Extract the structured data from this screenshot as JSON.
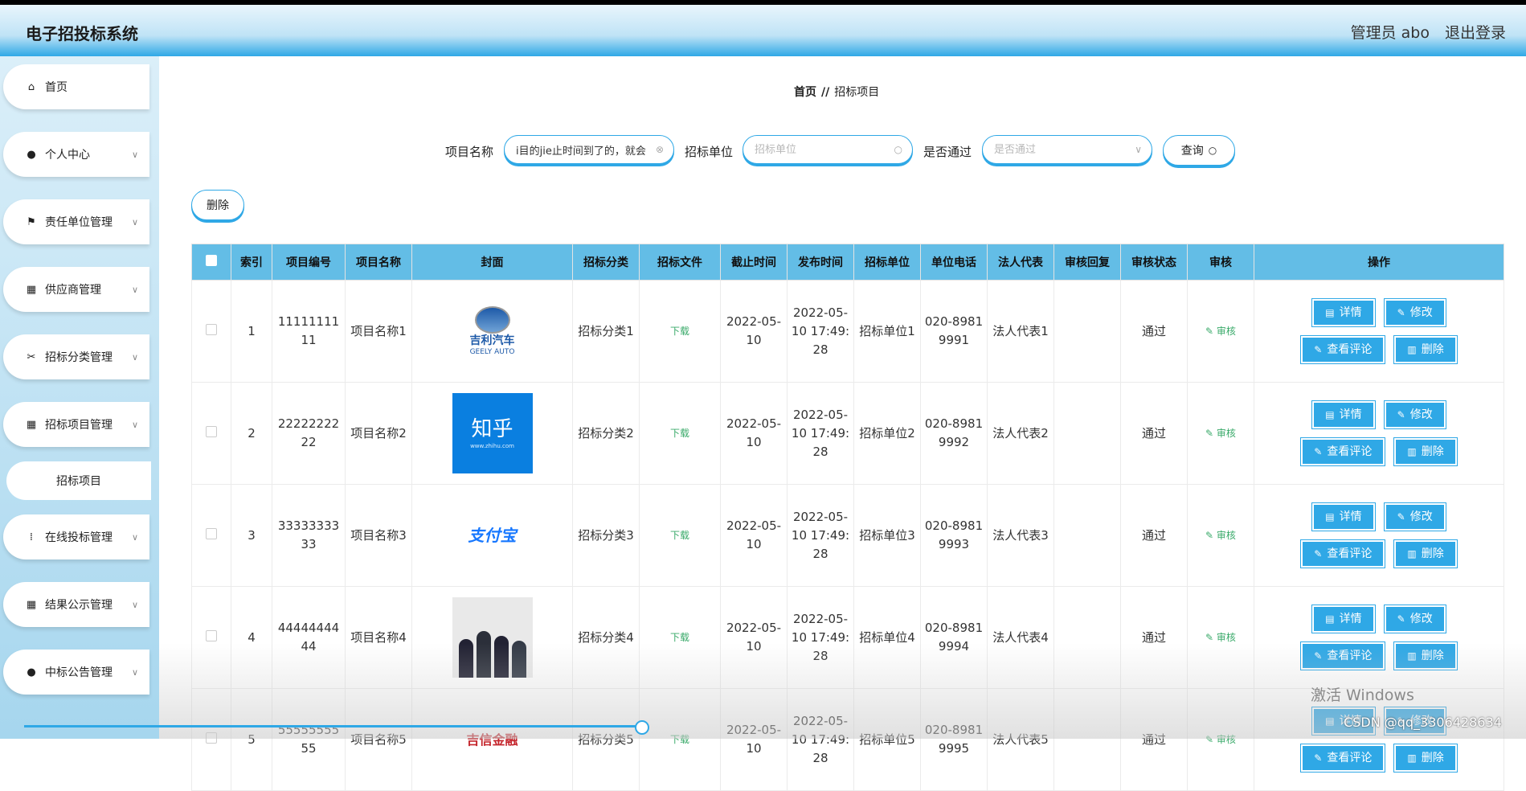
{
  "header": {
    "title": "电子招投标系统",
    "admin": "管理员 abo",
    "logout": "退出登录"
  },
  "sidebar": {
    "items": [
      {
        "label": "首页",
        "icon": "home-icon",
        "chevron": false
      },
      {
        "label": "个人中心",
        "icon": "user-icon",
        "chevron": true
      },
      {
        "label": "责任单位管理",
        "icon": "flag-icon",
        "chevron": true
      },
      {
        "label": "供应商管理",
        "icon": "grid-icon",
        "chevron": true
      },
      {
        "label": "招标分类管理",
        "icon": "ticket-icon",
        "chevron": true
      },
      {
        "label": "招标项目管理",
        "icon": "grid-icon",
        "chevron": true
      },
      {
        "label": "在线投标管理",
        "icon": "apps-icon",
        "chevron": true
      },
      {
        "label": "结果公示管理",
        "icon": "grid-icon",
        "chevron": true
      },
      {
        "label": "中标公告管理",
        "icon": "bulb-icon",
        "chevron": true
      }
    ],
    "submenu": "招标项目"
  },
  "breadcrumb": {
    "home": "首页",
    "sep": "//",
    "current": "招标项目"
  },
  "search": {
    "name_label": "项目名称",
    "name_value": "i目的jie止时间到了的，就会",
    "unit_label": "招标单位",
    "unit_placeholder": "招标单位",
    "pass_label": "是否通过",
    "pass_placeholder": "是否通过",
    "query": "查询"
  },
  "delete_button": "删除",
  "table": {
    "headers": [
      "索引",
      "项目编号",
      "项目名称",
      "封面",
      "招标分类",
      "招标文件",
      "截止时间",
      "发布时间",
      "招标单位",
      "单位电话",
      "法人代表",
      "审核回复",
      "审核状态",
      "审核",
      "操作"
    ],
    "rows": [
      {
        "idx": "1",
        "code": "1111111111",
        "name": "项目名称1",
        "cover": "GEELY AUTO logo",
        "cover_text": "吉利汽车",
        "cover_sub": "GEELY AUTO",
        "cat": "招标分类1",
        "file": "下载",
        "deadline": "2022-05-10",
        "publish": "2022-05-10 17:49:28",
        "unit": "招标单位1",
        "phone": "020-89819991",
        "legal": "法人代表1",
        "reply": "",
        "status": "通过",
        "audit": "审核"
      },
      {
        "idx": "2",
        "code": "2222222222",
        "name": "项目名称2",
        "cover": "Zhihu logo",
        "cover_text": "知乎",
        "cover_sub": "www.zhihu.com",
        "cat": "招标分类2",
        "file": "下载",
        "deadline": "2022-05-10",
        "publish": "2022-05-10 17:49:28",
        "unit": "招标单位2",
        "phone": "020-89819992",
        "legal": "法人代表2",
        "reply": "",
        "status": "通过",
        "audit": "审核"
      },
      {
        "idx": "3",
        "code": "3333333333",
        "name": "项目名称3",
        "cover": "Alipay logo",
        "cover_text": "支付宝",
        "cover_sub": "",
        "cat": "招标分类3",
        "file": "下载",
        "deadline": "2022-05-10",
        "publish": "2022-05-10 17:49:28",
        "unit": "招标单位3",
        "phone": "020-89819993",
        "legal": "法人代表3",
        "reply": "",
        "status": "通过",
        "audit": "审核"
      },
      {
        "idx": "4",
        "code": "4444444444",
        "name": "项目名称4",
        "cover": "business meeting photo",
        "cover_text": "",
        "cover_sub": "",
        "cat": "招标分类4",
        "file": "下载",
        "deadline": "2022-05-10",
        "publish": "2022-05-10 17:49:28",
        "unit": "招标单位4",
        "phone": "020-89819994",
        "legal": "法人代表4",
        "reply": "",
        "status": "通过",
        "audit": "审核"
      },
      {
        "idx": "5",
        "code": "5555555555",
        "name": "项目名称5",
        "cover": "logo",
        "cover_text": "吉信金融",
        "cover_sub": "",
        "cat": "招标分类5",
        "file": "下载",
        "deadline": "2022-05-10",
        "publish": "2022-05-10 17:49:28",
        "unit": "招标单位5",
        "phone": "020-89819995",
        "legal": "法人代表5",
        "reply": "",
        "status": "通过",
        "audit": "审核"
      }
    ],
    "ops": {
      "detail": "详情",
      "edit": "修改",
      "comments": "查看评论",
      "delete": "删除"
    }
  },
  "overlay": {
    "windows": "激活 Windows",
    "csdn": "CSDN @qq_3306428634"
  },
  "colors": {
    "accent": "#2fa8e6",
    "table_header": "#63bde6",
    "success": "#3aaa6a"
  }
}
